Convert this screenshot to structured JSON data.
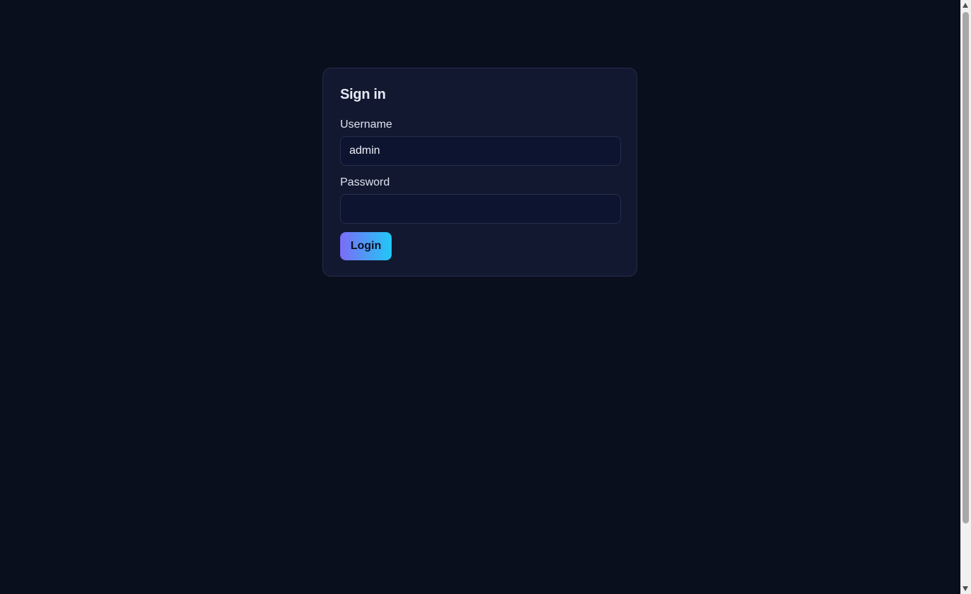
{
  "login_card": {
    "title": "Sign in",
    "username_label": "Username",
    "username_value": "admin",
    "password_label": "Password",
    "password_value": "",
    "login_button_label": "Login"
  },
  "theme": {
    "background": "#0a0f1e",
    "card_background": "#121830",
    "button_gradient_start": "#7b6cf6",
    "button_gradient_end": "#21c8f6"
  }
}
